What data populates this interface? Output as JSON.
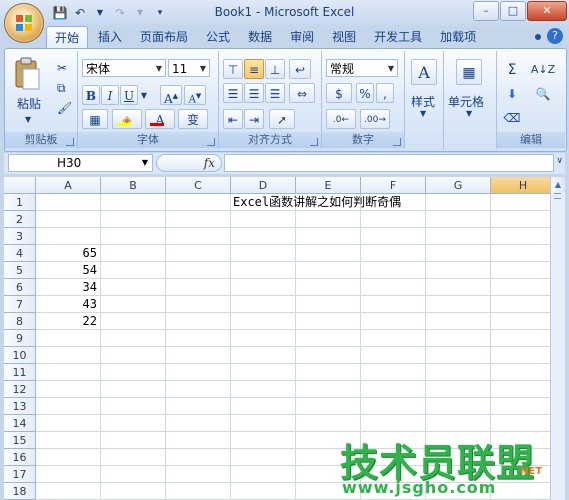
{
  "window": {
    "title": "Book1 - Microsoft Excel"
  },
  "qat": {
    "save_icon": "save-icon",
    "undo_icon": "undo-icon",
    "redo_icon": "redo-icon",
    "customize_icon": "customize-qat-icon"
  },
  "tabs": [
    {
      "label": "开始",
      "active": true
    },
    {
      "label": "插入"
    },
    {
      "label": "页面布局"
    },
    {
      "label": "公式"
    },
    {
      "label": "数据"
    },
    {
      "label": "审阅"
    },
    {
      "label": "视图"
    },
    {
      "label": "开发工具"
    },
    {
      "label": "加载项"
    }
  ],
  "ribbon": {
    "clipboard": {
      "label": "剪贴板",
      "paste": "粘贴"
    },
    "font": {
      "label": "字体",
      "name": "宋体",
      "size": "11",
      "bold": "B",
      "italic": "I",
      "underline": "U",
      "grow": "A",
      "shrink": "A",
      "font_color": "A",
      "phonetic": "变"
    },
    "alignment": {
      "label": "对齐方式"
    },
    "number": {
      "label": "数字",
      "format": "常规",
      "percent": "%",
      "comma": ","
    },
    "styles": {
      "label": "样式"
    },
    "cells": {
      "label": "单元格"
    },
    "editing": {
      "label": "编辑",
      "sum": "Σ"
    }
  },
  "formula_bar": {
    "name_box": "H30",
    "fx": "fx",
    "formula": ""
  },
  "sheet": {
    "columns": [
      "A",
      "B",
      "C",
      "D",
      "E",
      "F",
      "G",
      "H"
    ],
    "selected_column": "H",
    "rows": [
      "1",
      "2",
      "3",
      "4",
      "5",
      "6",
      "7",
      "8",
      "9",
      "10",
      "11",
      "12",
      "13",
      "14",
      "15",
      "16",
      "17",
      "18"
    ],
    "title_cell": "Excel函数讲解之如何判断奇偶",
    "values": [
      "65",
      "54",
      "34",
      "43",
      "22"
    ]
  },
  "watermark": {
    "text": "技术员联盟",
    "url": "www.jsgho.com",
    "small": "NET"
  },
  "colors": {
    "accent": "#15428b",
    "selected_header": "#f1c15f",
    "watermark": "#2fb34a"
  }
}
